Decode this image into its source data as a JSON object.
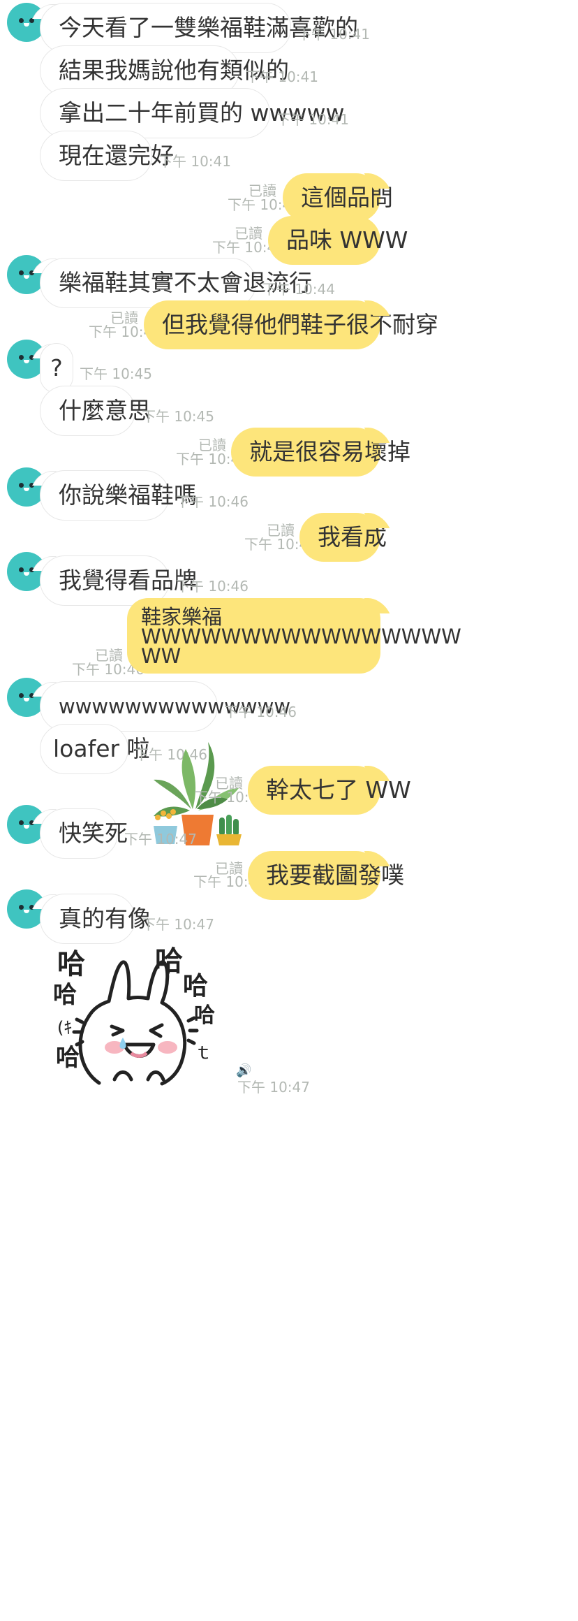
{
  "messages": [
    {
      "side": "in",
      "avatar": true,
      "text": "今天看了一雙樂福鞋滿喜歡的",
      "time": "下午 10:41"
    },
    {
      "side": "in",
      "text": "結果我媽說他有類似的",
      "time": "下午 10:41"
    },
    {
      "side": "in",
      "text": "拿出二十年前買的 wwwww",
      "time": "下午 10:41"
    },
    {
      "side": "in",
      "text": "現在還完好",
      "time": "下午 10:41"
    },
    {
      "side": "out",
      "read": "已讀",
      "text": "這個品問",
      "time": "下午 10:44"
    },
    {
      "side": "out",
      "read": "已讀",
      "text": "品味 WWW",
      "time": "下午 10:44"
    },
    {
      "side": "in",
      "avatar": true,
      "text": "樂福鞋其實不太會退流行",
      "time": "下午 10:44"
    },
    {
      "side": "out",
      "read": "已讀",
      "text": "但我覺得他們鞋子很不耐穿",
      "time": "下午 10:45"
    },
    {
      "side": "in",
      "avatar": true,
      "text": "?",
      "time": "下午 10:45"
    },
    {
      "side": "in",
      "text": "什麼意思",
      "time": "下午 10:45"
    },
    {
      "side": "out",
      "read": "已讀",
      "text": "就是很容易壞掉",
      "time": "下午 10:46"
    },
    {
      "side": "in",
      "avatar": true,
      "text": "你說樂福鞋嗎",
      "time": "下午 10:46"
    },
    {
      "side": "out",
      "read": "已讀",
      "text": "我看成",
      "time": "下午 10:46"
    },
    {
      "side": "in",
      "avatar": true,
      "text": "我覺得看品牌",
      "time": "下午 10:46"
    },
    {
      "side": "out",
      "read": "已讀",
      "text": "鞋家樂福\nWWWWWWWWWWWWWWWW\nWW",
      "time": "下午 10:46"
    },
    {
      "side": "in",
      "avatar": true,
      "text": "wwwwwwwwwwwwww",
      "time": "下午 10:46"
    },
    {
      "side": "in",
      "text": "loafer 啦",
      "time": "下午 10:46"
    },
    {
      "side": "out",
      "read": "已讀",
      "text": "幹太七了 WW",
      "time": "下午 10:47"
    },
    {
      "side": "in",
      "avatar": true,
      "text": "快笑死",
      "time": "下午 10:47"
    },
    {
      "side": "out",
      "read": "已讀",
      "text": "我要截圖發噗",
      "time": "下午 10:47"
    },
    {
      "side": "in",
      "avatar": true,
      "text": "真的有像",
      "time": "下午 10:47"
    },
    {
      "side": "in",
      "sticker": "laughing-bunny",
      "time": "下午 10:47"
    }
  ],
  "sticker_text": {
    "ha": "哈",
    "te": "ｔ",
    "sweat": "(ｷ"
  },
  "colors": {
    "out_bubble": "#fde57b",
    "in_bubble": "#ffffff",
    "avatar": "#3fc4c0",
    "meta": "#b3b8b3"
  }
}
